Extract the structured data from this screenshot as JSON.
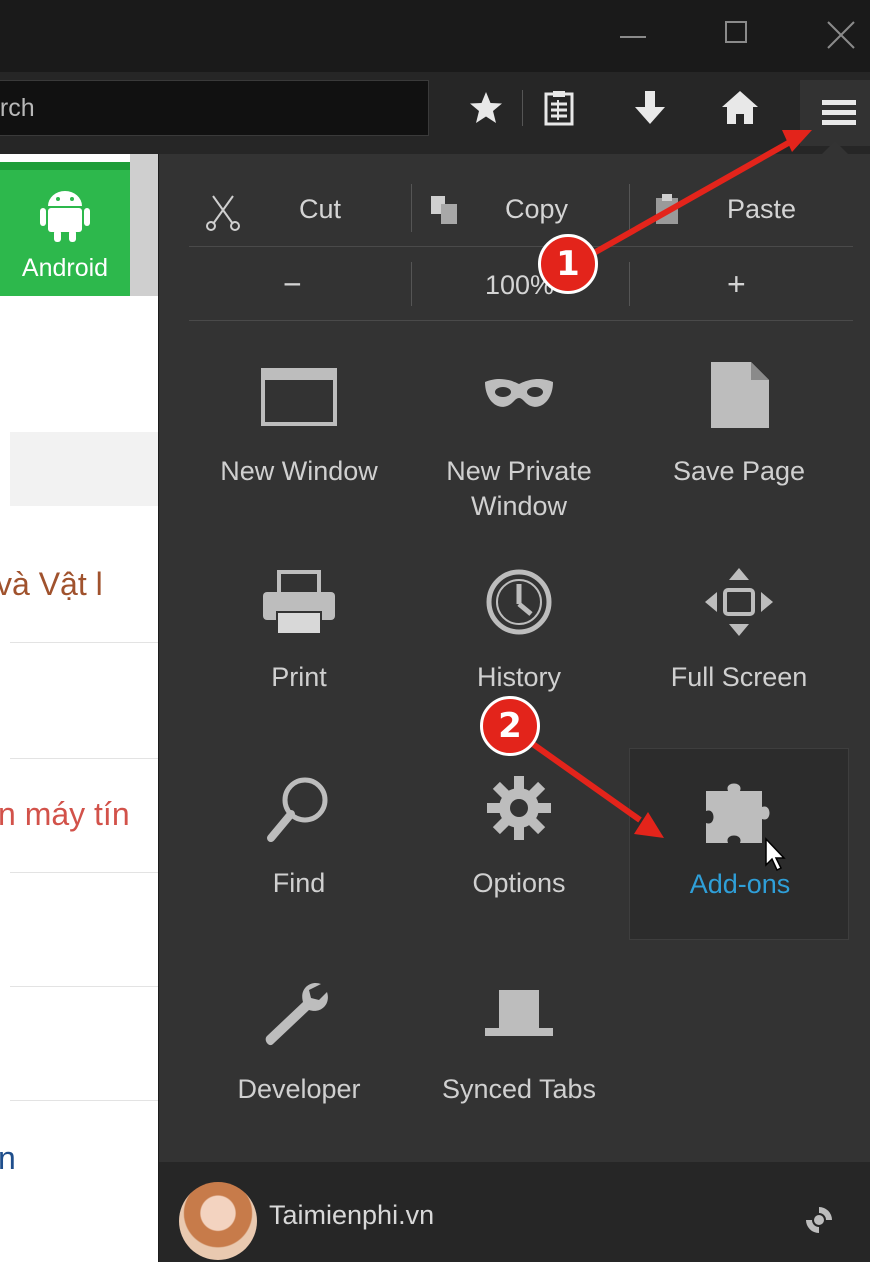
{
  "toolbar": {
    "search_placeholder": "arch"
  },
  "page": {
    "android_tile": "Android",
    "snippets": [
      "và Vật l",
      "n máy tín",
      "n"
    ]
  },
  "menu": {
    "edit": {
      "cut": "Cut",
      "copy": "Copy",
      "paste": "Paste"
    },
    "zoom": {
      "minus": "−",
      "level": "100%",
      "plus": "+"
    },
    "items": [
      {
        "label": "New Window",
        "icon": "new-window-icon"
      },
      {
        "label": "New Private\nWindow",
        "icon": "private-mask-icon"
      },
      {
        "label": "Save Page",
        "icon": "save-page-icon"
      },
      {
        "label": "Print",
        "icon": "printer-icon"
      },
      {
        "label": "History",
        "icon": "clock-icon"
      },
      {
        "label": "Full Screen",
        "icon": "fullscreen-icon"
      },
      {
        "label": "Find",
        "icon": "magnifier-icon"
      },
      {
        "label": "Options",
        "icon": "gear-icon"
      },
      {
        "label": "Add-ons",
        "icon": "puzzle-icon"
      },
      {
        "label": "Developer",
        "icon": "wrench-icon"
      },
      {
        "label": "Synced Tabs",
        "icon": "synced-tabs-icon"
      }
    ],
    "footer": {
      "account_name": "Taimienphi.vn"
    }
  },
  "annotations": {
    "step1": "1",
    "step2": "2"
  },
  "colors": {
    "accent_link": "#2f9fd8",
    "annotation_red": "#e3241b",
    "android_green": "#2db84c"
  }
}
